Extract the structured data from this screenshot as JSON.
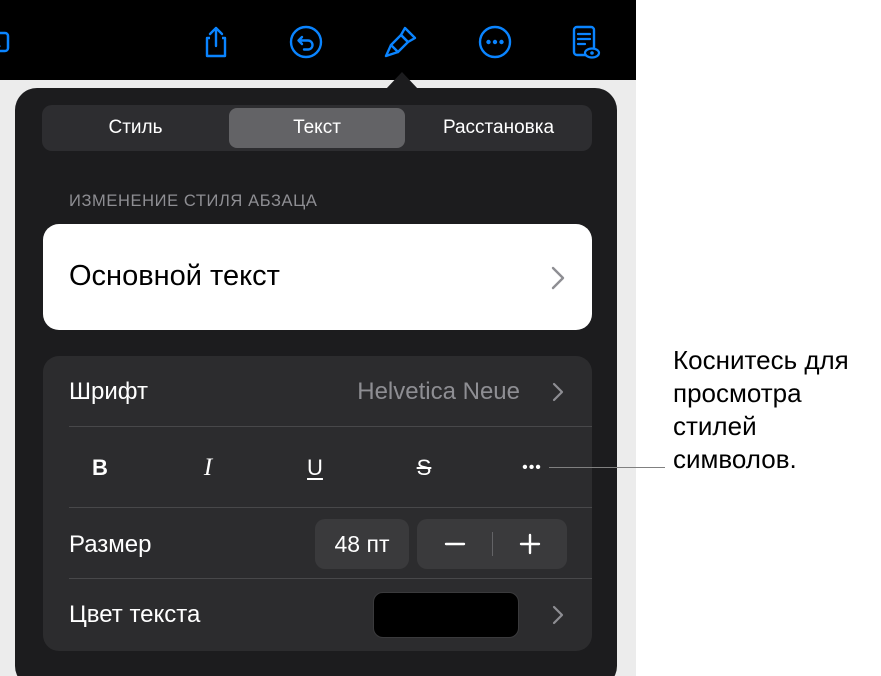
{
  "toolbar": {
    "icons": [
      "photo-icon",
      "share-icon",
      "undo-icon",
      "format-brush-icon",
      "more-icon",
      "reading-view-icon"
    ],
    "accent_color": "#0a84ff"
  },
  "popover": {
    "tabs": [
      {
        "label": "Стиль",
        "active": false
      },
      {
        "label": "Текст",
        "active": true
      },
      {
        "label": "Расстановка",
        "active": false
      }
    ],
    "section_header": "ИЗМЕНЕНИЕ СТИЛЯ АБЗАЦА",
    "paragraph_style": "Основной текст",
    "font": {
      "label": "Шрифт",
      "value": "Helvetica Neue"
    },
    "format_buttons": [
      "B",
      "I",
      "U",
      "S",
      "•••"
    ],
    "size": {
      "label": "Размер",
      "value": "48 пт",
      "minus": "−",
      "plus": "+"
    },
    "text_color": {
      "label": "Цвет текста",
      "swatch": "#000000"
    }
  },
  "callout": {
    "text": "Коснитесь для\nпросмотра\nстилей\nсимволов."
  }
}
